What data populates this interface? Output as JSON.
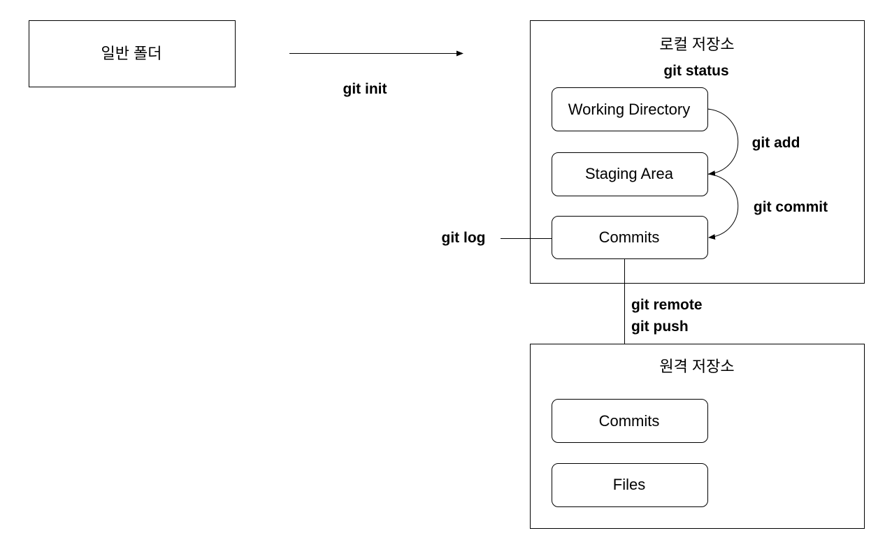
{
  "nodes": {
    "plain_folder": "일반 폴더",
    "local_repo": "로컬 저장소",
    "working_directory": "Working Directory",
    "staging_area": "Staging Area",
    "local_commits": "Commits",
    "remote_repo": "원격 저장소",
    "remote_commits": "Commits",
    "remote_files": "Files"
  },
  "commands": {
    "init": "git init",
    "status": "git status",
    "add": "git add",
    "commit": "git commit",
    "log": "git log",
    "remote": "git remote",
    "push": "git push"
  }
}
